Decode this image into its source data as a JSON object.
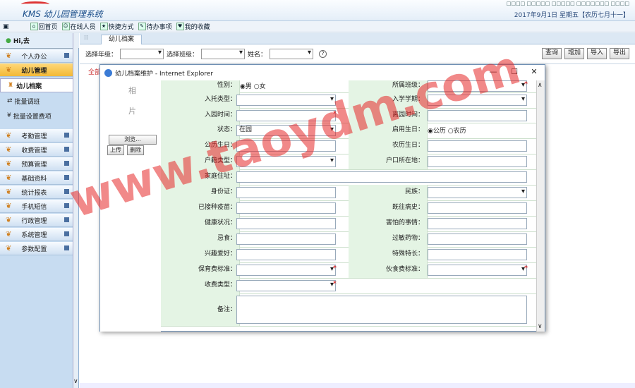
{
  "app": {
    "logo_text": "KMS 幼儿园管理系统",
    "top_links": "□□□□ □□□□□ □□□□□ □□□□□□□ □□□□",
    "date_line": "2017年9月1日 星期五【农历七月十一】"
  },
  "toolbar": {
    "items": [
      {
        "icon": "home-icon",
        "label": "回首页"
      },
      {
        "icon": "users-online-icon",
        "label": "在线人员"
      },
      {
        "icon": "shortcut-icon",
        "label": "快捷方式"
      },
      {
        "icon": "todo-icon",
        "label": "待办事项"
      },
      {
        "icon": "favorites-icon",
        "label": "我的收藏"
      }
    ],
    "toggle_label": "▣"
  },
  "sidebar": {
    "greeting": "Hi,去",
    "menus": [
      {
        "label": "个人办公"
      },
      {
        "label": "幼儿管理",
        "active": true
      }
    ],
    "sub_header": "幼儿档案",
    "sub_items": [
      {
        "label": "批量调班"
      },
      {
        "label": "批量设置费项"
      }
    ],
    "more_menus": [
      {
        "label": "考勤管理"
      },
      {
        "label": "收费管理"
      },
      {
        "label": "预算管理"
      },
      {
        "label": "基础资料"
      },
      {
        "label": "统计报表"
      },
      {
        "label": "手机短信"
      },
      {
        "label": "行政管理"
      },
      {
        "label": "系统管理"
      },
      {
        "label": "参数配置"
      }
    ]
  },
  "main": {
    "tab_label": "幼儿档案",
    "filter": {
      "year_label": "选择年级：",
      "class_label": "选择班级：",
      "name_label": "姓名：",
      "help_icon": "?"
    },
    "buttons": {
      "query": "查询",
      "add": "增加",
      "import": "导入",
      "export": "导出"
    },
    "grid_header": "全部"
  },
  "dialog": {
    "title": "幼儿档案维护 - Internet Explorer",
    "photo_label_1": "相",
    "photo_label_2": "片",
    "browse_label": "浏览...",
    "upload_label": "上传",
    "delete_label": "删除",
    "gender": {
      "label": "性别：",
      "male": "男",
      "female": "女",
      "selected": "男"
    },
    "class_label": "所属班级：",
    "enroll_type_label": "入托类型：",
    "school_term_label": "入学学期：",
    "enroll_time_label": "入园时间：",
    "leave_time_label": "离园时间：",
    "status_label": "状态：",
    "status_value": "在园",
    "birthday_type": {
      "label": "启用生日：",
      "solar": "公历",
      "lunar": "农历",
      "selected": "公历"
    },
    "solar_birthday_label": "公历生日：",
    "lunar_birthday_label": "农历生日：",
    "hukou_type_label": "户籍类型：",
    "hukou_location_label": "户口所在地：",
    "home_address_label": "家庭住址：",
    "id_card_label": "身份证：",
    "ethnicity_label": "民族：",
    "vaccinated_label": "已接种疫苗：",
    "past_illness_label": "既往病史：",
    "health_label": "健康状况：",
    "fears_label": "害怕的事情：",
    "diet_label": "忌食：",
    "allergy_label": "过敏药物：",
    "hobby_label": "兴趣爱好：",
    "special_skill_label": "特殊特长：",
    "care_fee_label": "保育费标准：",
    "meal_fee_label": "伙食费标准：",
    "fee_type_label": "收费类型：",
    "remark_label": "备注："
  },
  "watermark": "www.taoydm.com"
}
